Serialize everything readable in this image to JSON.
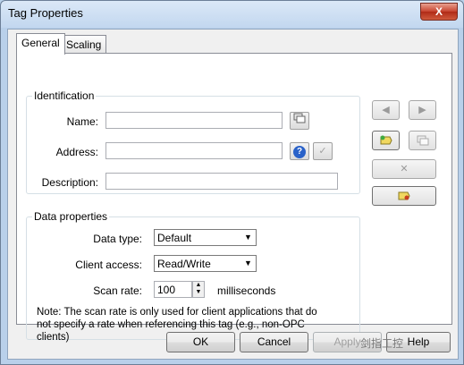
{
  "window": {
    "title": "Tag Properties",
    "close_glyph": "X"
  },
  "tabs": [
    {
      "label": "General"
    },
    {
      "label": "Scaling"
    }
  ],
  "identification": {
    "group_label": "Identification",
    "name_label": "Name:",
    "name_value": "",
    "address_label": "Address:",
    "address_value": "",
    "description_label": "Description:",
    "description_value": ""
  },
  "data_properties": {
    "group_label": "Data properties",
    "data_type_label": "Data type:",
    "data_type_value": "Default",
    "client_access_label": "Client access:",
    "client_access_value": "Read/Write",
    "scan_rate_label": "Scan rate:",
    "scan_rate_value": "100",
    "scan_rate_unit": "milliseconds",
    "note": "Note:  The scan rate is only used for client applications that do not specify a rate when referencing this tag (e.g., non-OPC clients)"
  },
  "side_buttons": {
    "prev_glyph": "◀",
    "next_glyph": "▶",
    "delete_glyph": "✕"
  },
  "icon_buttons": {
    "address_hint_glyph": "?",
    "address_check_glyph": "✓"
  },
  "buttons": {
    "ok": "OK",
    "cancel": "Cancel",
    "apply": "Apply",
    "help": "Help"
  },
  "watermark": "剑指工控",
  "colors": {
    "title_bar": "#c2d7ef",
    "close": "#c7432e",
    "hint_icon": "#2a62c9"
  }
}
